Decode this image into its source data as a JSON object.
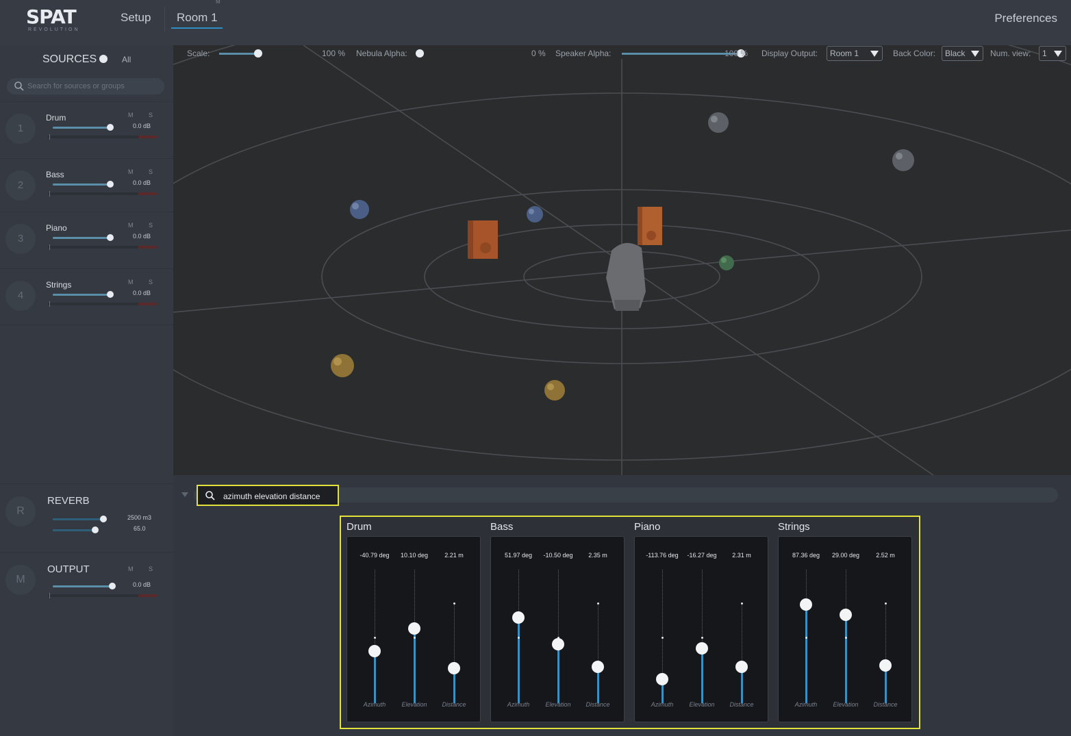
{
  "app": {
    "logo_text": "SPAT",
    "logo_subtext": "REVOLUTION",
    "tabs": [
      {
        "label": "Setup",
        "active": false
      },
      {
        "label": "Room 1",
        "active": true
      }
    ],
    "tab_marker": "M",
    "preferences_label": "Preferences"
  },
  "sidebar": {
    "sources_title": "SOURCES",
    "all_label": "All",
    "search_placeholder": "Search for sources or groups",
    "sources": [
      {
        "num": "1",
        "name": "Drum",
        "m": "M",
        "s": "S",
        "db": "0.0 dB",
        "level": 0.95
      },
      {
        "num": "2",
        "name": "Bass",
        "m": "M",
        "s": "S",
        "db": "0.0 dB",
        "level": 0.95
      },
      {
        "num": "3",
        "name": "Piano",
        "m": "M",
        "s": "S",
        "db": "0.0 dB",
        "level": 0.95
      },
      {
        "num": "4",
        "name": "Strings",
        "m": "M",
        "s": "S",
        "db": "0.0 dB",
        "level": 0.95
      }
    ],
    "reverb": {
      "num": "R",
      "title": "REVERB",
      "volume": "2500 m3",
      "rt": "65.0"
    },
    "output": {
      "num": "M",
      "title": "OUTPUT",
      "m": "M",
      "s": "S",
      "db": "0.0 dB"
    }
  },
  "viewport_toolbar": {
    "scale_label": "Scale:",
    "scale_value": "100 %",
    "nebula_label": "Nebula Alpha:",
    "nebula_value": "0 %",
    "speaker_label": "Speaker Alpha:",
    "speaker_value": "100 %",
    "display_output_label": "Display Output:",
    "display_output_value": "Room 1",
    "back_color_label": "Back Color:",
    "back_color_value": "Black",
    "num_view_label": "Num. view:",
    "num_view_value": "1"
  },
  "param_search": {
    "value": "azimuth elevation distance"
  },
  "panels": [
    {
      "title": "Drum",
      "azimuth": "-40.79 deg",
      "elevation": "10.10 deg",
      "distance": "2.21 m",
      "az_level": 0.39,
      "el_level": 0.56,
      "di_level": 0.26
    },
    {
      "title": "Bass",
      "azimuth": "51.97 deg",
      "elevation": "-10.50 deg",
      "distance": "2.35 m",
      "az_level": 0.64,
      "el_level": 0.44,
      "di_level": 0.27
    },
    {
      "title": "Piano",
      "azimuth": "-113.76 deg",
      "elevation": "-16.27 deg",
      "distance": "2.31 m",
      "az_level": 0.18,
      "el_level": 0.41,
      "di_level": 0.27
    },
    {
      "title": "Strings",
      "azimuth": "87.36 deg",
      "elevation": "29.00 deg",
      "distance": "2.52 m",
      "az_level": 0.74,
      "el_level": 0.66,
      "di_level": 0.28
    }
  ],
  "axis_labels": {
    "azimuth": "Azimuth",
    "elevation": "Elevation",
    "distance": "Distance"
  },
  "colors": {
    "accent_blue": "#3d8fbf",
    "highlight_yellow": "#e2e23a",
    "speaker_orange": "#c0602a"
  }
}
